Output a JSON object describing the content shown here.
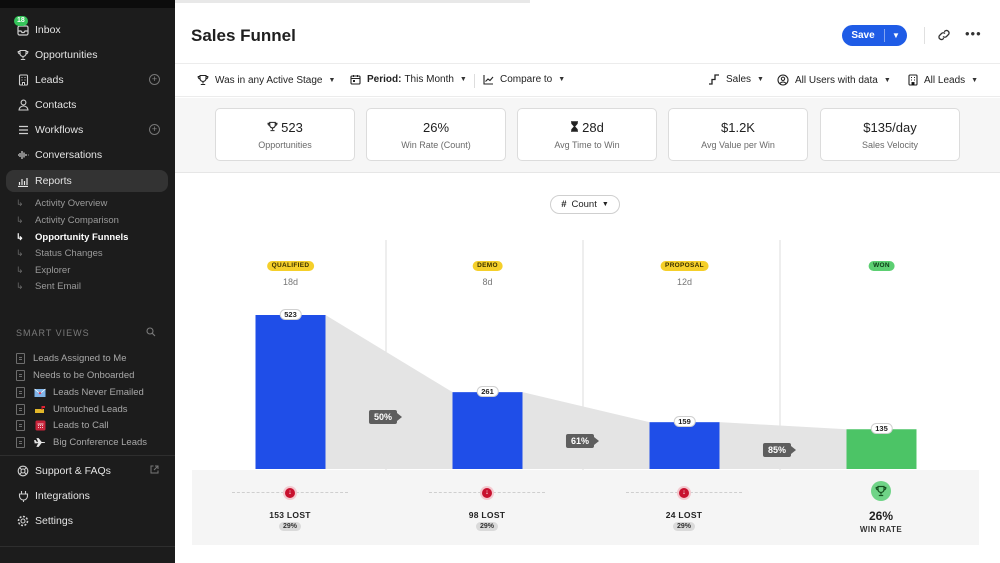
{
  "sidebar": {
    "inbox_badge": "18",
    "nav": [
      {
        "label": "Inbox"
      },
      {
        "label": "Opportunities"
      },
      {
        "label": "Leads"
      },
      {
        "label": "Contacts"
      },
      {
        "label": "Workflows"
      },
      {
        "label": "Conversations"
      },
      {
        "label": "Reports"
      }
    ],
    "reports_sub": [
      {
        "label": "Activity Overview"
      },
      {
        "label": "Activity Comparison"
      },
      {
        "label": "Opportunity Funnels"
      },
      {
        "label": "Status Changes"
      },
      {
        "label": "Explorer"
      },
      {
        "label": "Sent Email"
      }
    ],
    "smart_views_title": "SMART VIEWS",
    "smart_views": [
      {
        "label": "Leads Assigned to Me"
      },
      {
        "label": "Needs to be Onboarded"
      },
      {
        "label": "Leads Never Emailed"
      },
      {
        "label": "Untouched Leads"
      },
      {
        "label": "Leads to Call"
      },
      {
        "label": "Big Conference Leads"
      }
    ],
    "footer": [
      {
        "label": "Support & FAQs"
      },
      {
        "label": "Integrations"
      },
      {
        "label": "Settings"
      }
    ]
  },
  "header": {
    "title": "Sales Funnel",
    "save_label": "Save"
  },
  "filters": {
    "stage": "Was in any Active Stage",
    "period_label": "Period:",
    "period_value": "This Month",
    "compare": "Compare to",
    "pipeline": "Sales",
    "users": "All Users with data",
    "leads": "All Leads"
  },
  "stats": [
    {
      "value": "523",
      "label": "Opportunities"
    },
    {
      "value": "26%",
      "label": "Win Rate (Count)"
    },
    {
      "value": "28d",
      "label": "Avg Time to Win"
    },
    {
      "value": "$1.2K",
      "label": "Avg Value per Win"
    },
    {
      "value": "$135/day",
      "label": "Sales Velocity"
    }
  ],
  "count_selector": "Count",
  "funnel": {
    "max_value": 523,
    "stages": [
      {
        "name": "QUALIFIED",
        "days": "18d",
        "value": 523,
        "color": "#1f4ee8"
      },
      {
        "name": "DEMO",
        "days": "8d",
        "value": 261,
        "color": "#1f4ee8"
      },
      {
        "name": "PROPOSAL",
        "days": "12d",
        "value": 159,
        "color": "#1f4ee8"
      },
      {
        "name": "WON",
        "days": "",
        "value": 135,
        "color": "#4cc466"
      }
    ],
    "conversions": [
      "50%",
      "61%",
      "85%"
    ],
    "lost": [
      {
        "count": "153 LOST",
        "pct": "29%"
      },
      {
        "count": "98 LOST",
        "pct": "29%"
      },
      {
        "count": "24 LOST",
        "pct": "29%"
      }
    ],
    "win_rate_value": "26%",
    "win_rate_label": "WIN RATE"
  }
}
